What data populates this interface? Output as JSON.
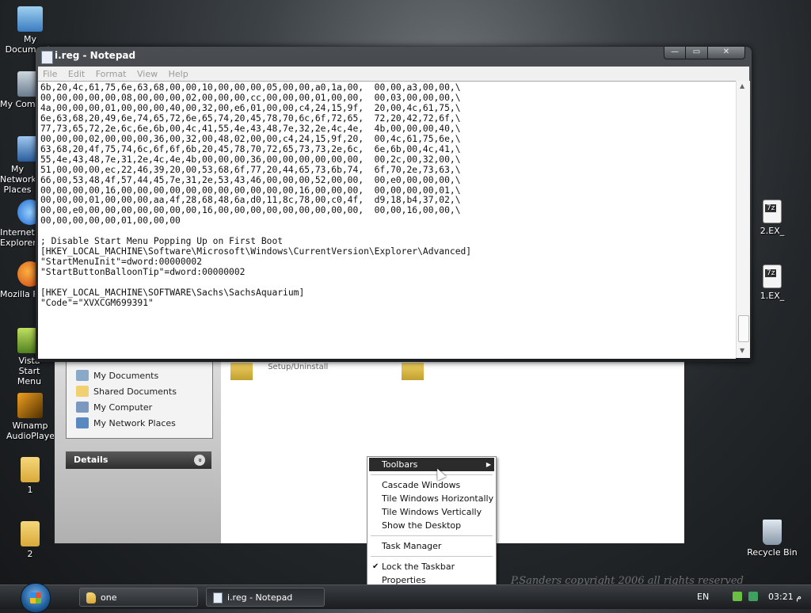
{
  "desktop": {
    "icons": [
      {
        "label": "My Documents",
        "icon": "my-documents-icon"
      },
      {
        "label": "My Computer",
        "icon": "my-computer-icon"
      },
      {
        "label": "My Network Places",
        "icon": "my-network-places-icon"
      },
      {
        "label": "Internet Explorer",
        "icon": "internet-explorer-icon"
      },
      {
        "label": "Mozilla Firefox",
        "icon": "firefox-icon"
      },
      {
        "label": "Vista Start Menu",
        "icon": "vista-start-menu-icon"
      },
      {
        "label": "Winamp AudioPlayer",
        "icon": "winamp-icon"
      },
      {
        "label": "1",
        "icon": "folder-icon"
      },
      {
        "label": "2",
        "icon": "folder-icon"
      },
      {
        "label": "2.EX_",
        "icon": "7z-file-icon",
        "badge": "7z"
      },
      {
        "label": "1.EX_",
        "icon": "7z-file-icon",
        "badge": "7z"
      },
      {
        "label": "Recycle Bin",
        "icon": "recycle-bin-icon"
      }
    ],
    "watermark": "P.Sanders copyright 2006 all rights reserved"
  },
  "explorer": {
    "tasks": [
      {
        "label": "My Documents",
        "icon": "my-documents-icon"
      },
      {
        "label": "Shared Documents",
        "icon": "shared-documents-icon"
      },
      {
        "label": "My Computer",
        "icon": "my-computer-icon"
      },
      {
        "label": "My Network Places",
        "icon": "my-network-places-icon"
      }
    ],
    "details_label": "Details",
    "details_chevron": "»",
    "setup_label": "Setup/Uninstall"
  },
  "notepad": {
    "title": "i.reg - Notepad",
    "controls": {
      "minimize": "—",
      "maximize": "▭",
      "close": "✕"
    },
    "menu": [
      "File",
      "Edit",
      "Format",
      "View",
      "Help"
    ],
    "content": "6b,20,4c,61,75,6e,63,68,00,00,10,00,00,00,05,00,00,a0,1a,00,  00,00,a3,00,00,\\\n00,00,00,00,00,08,00,00,00,02,00,00,00,cc,00,00,00,01,00,00,  00,03,00,00,00,\\\n4a,00,00,00,01,00,00,00,40,00,32,00,e6,01,00,00,c4,24,15,9f,  20,00,4c,61,75,\\\n6e,63,68,20,49,6e,74,65,72,6e,65,74,20,45,78,70,6c,6f,72,65,  72,20,42,72,6f,\\\n77,73,65,72,2e,6c,6e,6b,00,4c,41,55,4e,43,48,7e,32,2e,4c,4e,  4b,00,00,00,40,\\\n00,00,00,02,00,00,00,36,00,32,00,48,02,00,00,c4,24,15,9f,20,  00,4c,61,75,6e,\\\n63,68,20,4f,75,74,6c,6f,6f,6b,20,45,78,70,72,65,73,73,2e,6c,  6e,6b,00,4c,41,\\\n55,4e,43,48,7e,31,2e,4c,4e,4b,00,00,00,36,00,00,00,00,00,00,  00,2c,00,32,00,\\\n51,00,00,00,ec,22,46,39,20,00,53,68,6f,77,20,44,65,73,6b,74,  6f,70,2e,73,63,\\\n66,00,53,48,4f,57,44,45,7e,31,2e,53,43,46,00,00,00,52,00,00,  00,e0,00,00,00,\\\n00,00,00,00,16,00,00,00,00,00,00,00,00,00,00,00,16,00,00,00,  00,00,00,00,01,\\\n00,00,00,01,00,00,00,aa,4f,28,68,48,6a,d0,11,8c,78,00,c0,4f,  d9,18,b4,37,02,\\\n00,00,e0,00,00,00,00,00,00,00,16,00,00,00,00,00,00,00,00,00,  00,00,16,00,00,\\\n00,00,00,00,00,01,00,00,00\n\n; Disable Start Menu Popping Up on First Boot\n[HKEY_LOCAL_MACHINE\\Software\\Microsoft\\Windows\\CurrentVersion\\Explorer\\Advanced]\n\"StartMenuInit\"=dword:00000002\n\"StartButtonBalloonTip\"=dword:00000002\n\n[HKEY_LOCAL_MACHINE\\SOFTWARE\\Sachs\\SachsAquarium]\n\"Code\"=\"XVXCGM699391\""
  },
  "context_menu": {
    "items": [
      {
        "label": "Toolbars",
        "arrow": "▶",
        "highlighted": true
      },
      {
        "label": "Cascade Windows"
      },
      {
        "label": "Tile Windows Horizontally"
      },
      {
        "label": "Tile Windows Vertically"
      },
      {
        "label": "Show the Desktop"
      },
      {
        "label": "Task Manager"
      },
      {
        "label": "Lock the Taskbar",
        "check": "✔"
      },
      {
        "label": "Properties"
      }
    ]
  },
  "taskbar": {
    "buttons": [
      {
        "label": "one",
        "icon": "folder-icon"
      },
      {
        "label": "i.reg - Notepad",
        "icon": "notepad-icon"
      }
    ],
    "language": "EN",
    "clock": "03:21 م"
  }
}
